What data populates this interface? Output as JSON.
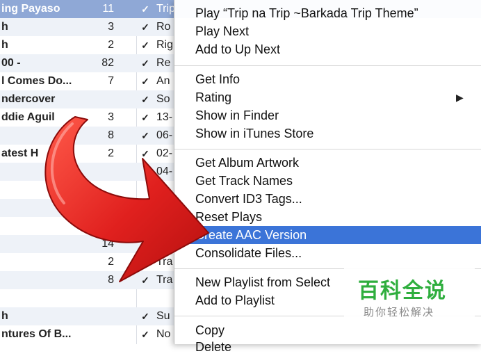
{
  "tracks": [
    {
      "name": "ing Payaso",
      "count": "11",
      "check": "✓",
      "song": "Trip"
    },
    {
      "name": "h",
      "count": "3",
      "check": "✓",
      "song": "Ro"
    },
    {
      "name": "h",
      "count": "2",
      "check": "✓",
      "song": "Rig"
    },
    {
      "name": "00 -",
      "count": "82",
      "check": "✓",
      "song": "Re"
    },
    {
      "name": "l Comes Do...",
      "count": "7",
      "check": "✓",
      "song": "An"
    },
    {
      "name": "ndercover",
      "count": "",
      "check": "✓",
      "song": "So"
    },
    {
      "name": "ddie Aguil",
      "count": "3",
      "check": "✓",
      "song": "13-"
    },
    {
      "name": "",
      "count": "8",
      "check": "✓",
      "song": "06-"
    },
    {
      "name": "atest H",
      "count": "2",
      "check": "✓",
      "song": "02-"
    },
    {
      "name": "",
      "count": "",
      "check": "",
      "song": "04-"
    },
    {
      "name": "",
      "count": "",
      "check": "",
      "song": ""
    },
    {
      "name": "",
      "count": "",
      "check": "",
      "song": ""
    },
    {
      "name": "",
      "count": "",
      "check": "",
      "song": ""
    },
    {
      "name": "",
      "count": "14",
      "check": "",
      "song": ""
    },
    {
      "name": "",
      "count": "2",
      "check": "✓",
      "song": "Tra"
    },
    {
      "name": "",
      "count": "8",
      "check": "✓",
      "song": "Tra"
    },
    {
      "name": "",
      "count": "",
      "check": "",
      "song": ""
    },
    {
      "name": "h",
      "count": "",
      "check": "✓",
      "song": "Su"
    },
    {
      "name": "ntures Of B...",
      "count": "",
      "check": "✓",
      "song": "No"
    }
  ],
  "menu": {
    "play": "Play “Trip na Trip ~Barkada Trip Theme”",
    "play_next": "Play Next",
    "add_up_next": "Add to Up Next",
    "get_info": "Get Info",
    "rating": "Rating",
    "rating_arrow": "▶",
    "show_finder": "Show in Finder",
    "show_store": "Show in iTunes Store",
    "get_artwork": "Get Album Artwork",
    "get_track_names": "Get Track Names",
    "convert_id3": "Convert ID3 Tags...",
    "reset_plays": "Reset Plays",
    "create_aac": "Create AAC Version",
    "consolidate": "Consolidate Files...",
    "new_playlist": "New Playlist from Select",
    "add_playlist": "Add to Playlist",
    "copy": "Copy",
    "delete": "Delete"
  },
  "watermark": {
    "logo": "百科全说",
    "sub": "助你轻松解决"
  },
  "colors": {
    "highlight": "#3b74d8",
    "arrow": "#e0201e",
    "watermark_green": "#2fae3e"
  }
}
